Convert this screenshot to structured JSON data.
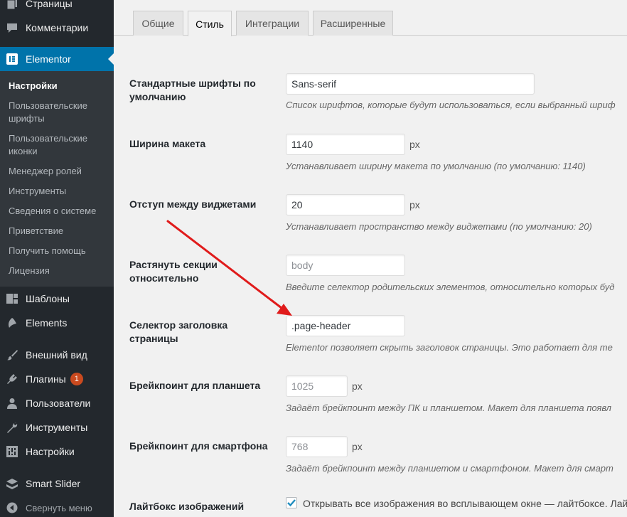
{
  "sidebar": {
    "pages": "Страницы",
    "comments": "Комментарии",
    "elementor": "Elementor",
    "submenu": [
      "Настройки",
      "Пользовательские шрифты",
      "Пользовательские иконки",
      "Менеджер ролей",
      "Инструменты",
      "Сведения о системе",
      "Приветствие",
      "Получить помощь",
      "Лицензия"
    ],
    "templates": "Шаблоны",
    "elements": "Elements",
    "appearance": "Внешний вид",
    "plugins": "Плагины",
    "plugins_badge": "1",
    "users": "Пользователи",
    "tools": "Инструменты",
    "settings": "Настройки",
    "smart_slider": "Smart Slider",
    "collapse": "Свернуть меню"
  },
  "tabs": [
    "Общие",
    "Стиль",
    "Интеграции",
    "Расширенные"
  ],
  "active_tab": "Стиль",
  "form": {
    "default_fonts": {
      "label": "Стандартные шрифты по умолчанию",
      "value": "Sans-serif",
      "description": "Список шрифтов, которые будут использоваться, если выбранный шриф"
    },
    "container_width": {
      "label": "Ширина макета",
      "value": "1140",
      "unit": "px",
      "description": "Устанавливает ширину макета по умолчанию (по умолчанию: 1140)"
    },
    "widgets_space": {
      "label": "Отступ между виджетами",
      "value": "20",
      "unit": "px",
      "description": "Устанавливает пространство между виджетами (по умолчанию: 20)"
    },
    "stretch_section": {
      "label": "Растянуть секции относительно",
      "placeholder": "body",
      "description": "Введите селектор родительских элементов, относительно которых буд"
    },
    "page_title_selector": {
      "label": "Селектор заголовка страницы",
      "value": ".page-header",
      "description": "Elementor позволяет скрыть заголовок страницы. Это работает для те"
    },
    "tablet_breakpoint": {
      "label": "Брейкпоинт для планшета",
      "placeholder": "1025",
      "unit": "px",
      "description": "Задаёт брейкпоинт между ПК и планшетом. Макет для планшета появл"
    },
    "mobile_breakpoint": {
      "label": "Брейкпоинт для смартфона",
      "placeholder": "768",
      "unit": "px",
      "description": "Задаёт брейкпоинт между планшетом и смартфоном. Макет для смарт"
    },
    "lightbox": {
      "label": "Лайтбокс изображений",
      "checkbox_label": "Открывать все изображения во всплывающем окне — лайтбоксе. Лайт",
      "checked": true
    }
  },
  "colors": {
    "sidebar_bg": "#23282d",
    "submenu_bg": "#32373c",
    "active_blue": "#0073aa",
    "badge": "#ca4a1f",
    "arrow_red": "#e01b1b"
  }
}
